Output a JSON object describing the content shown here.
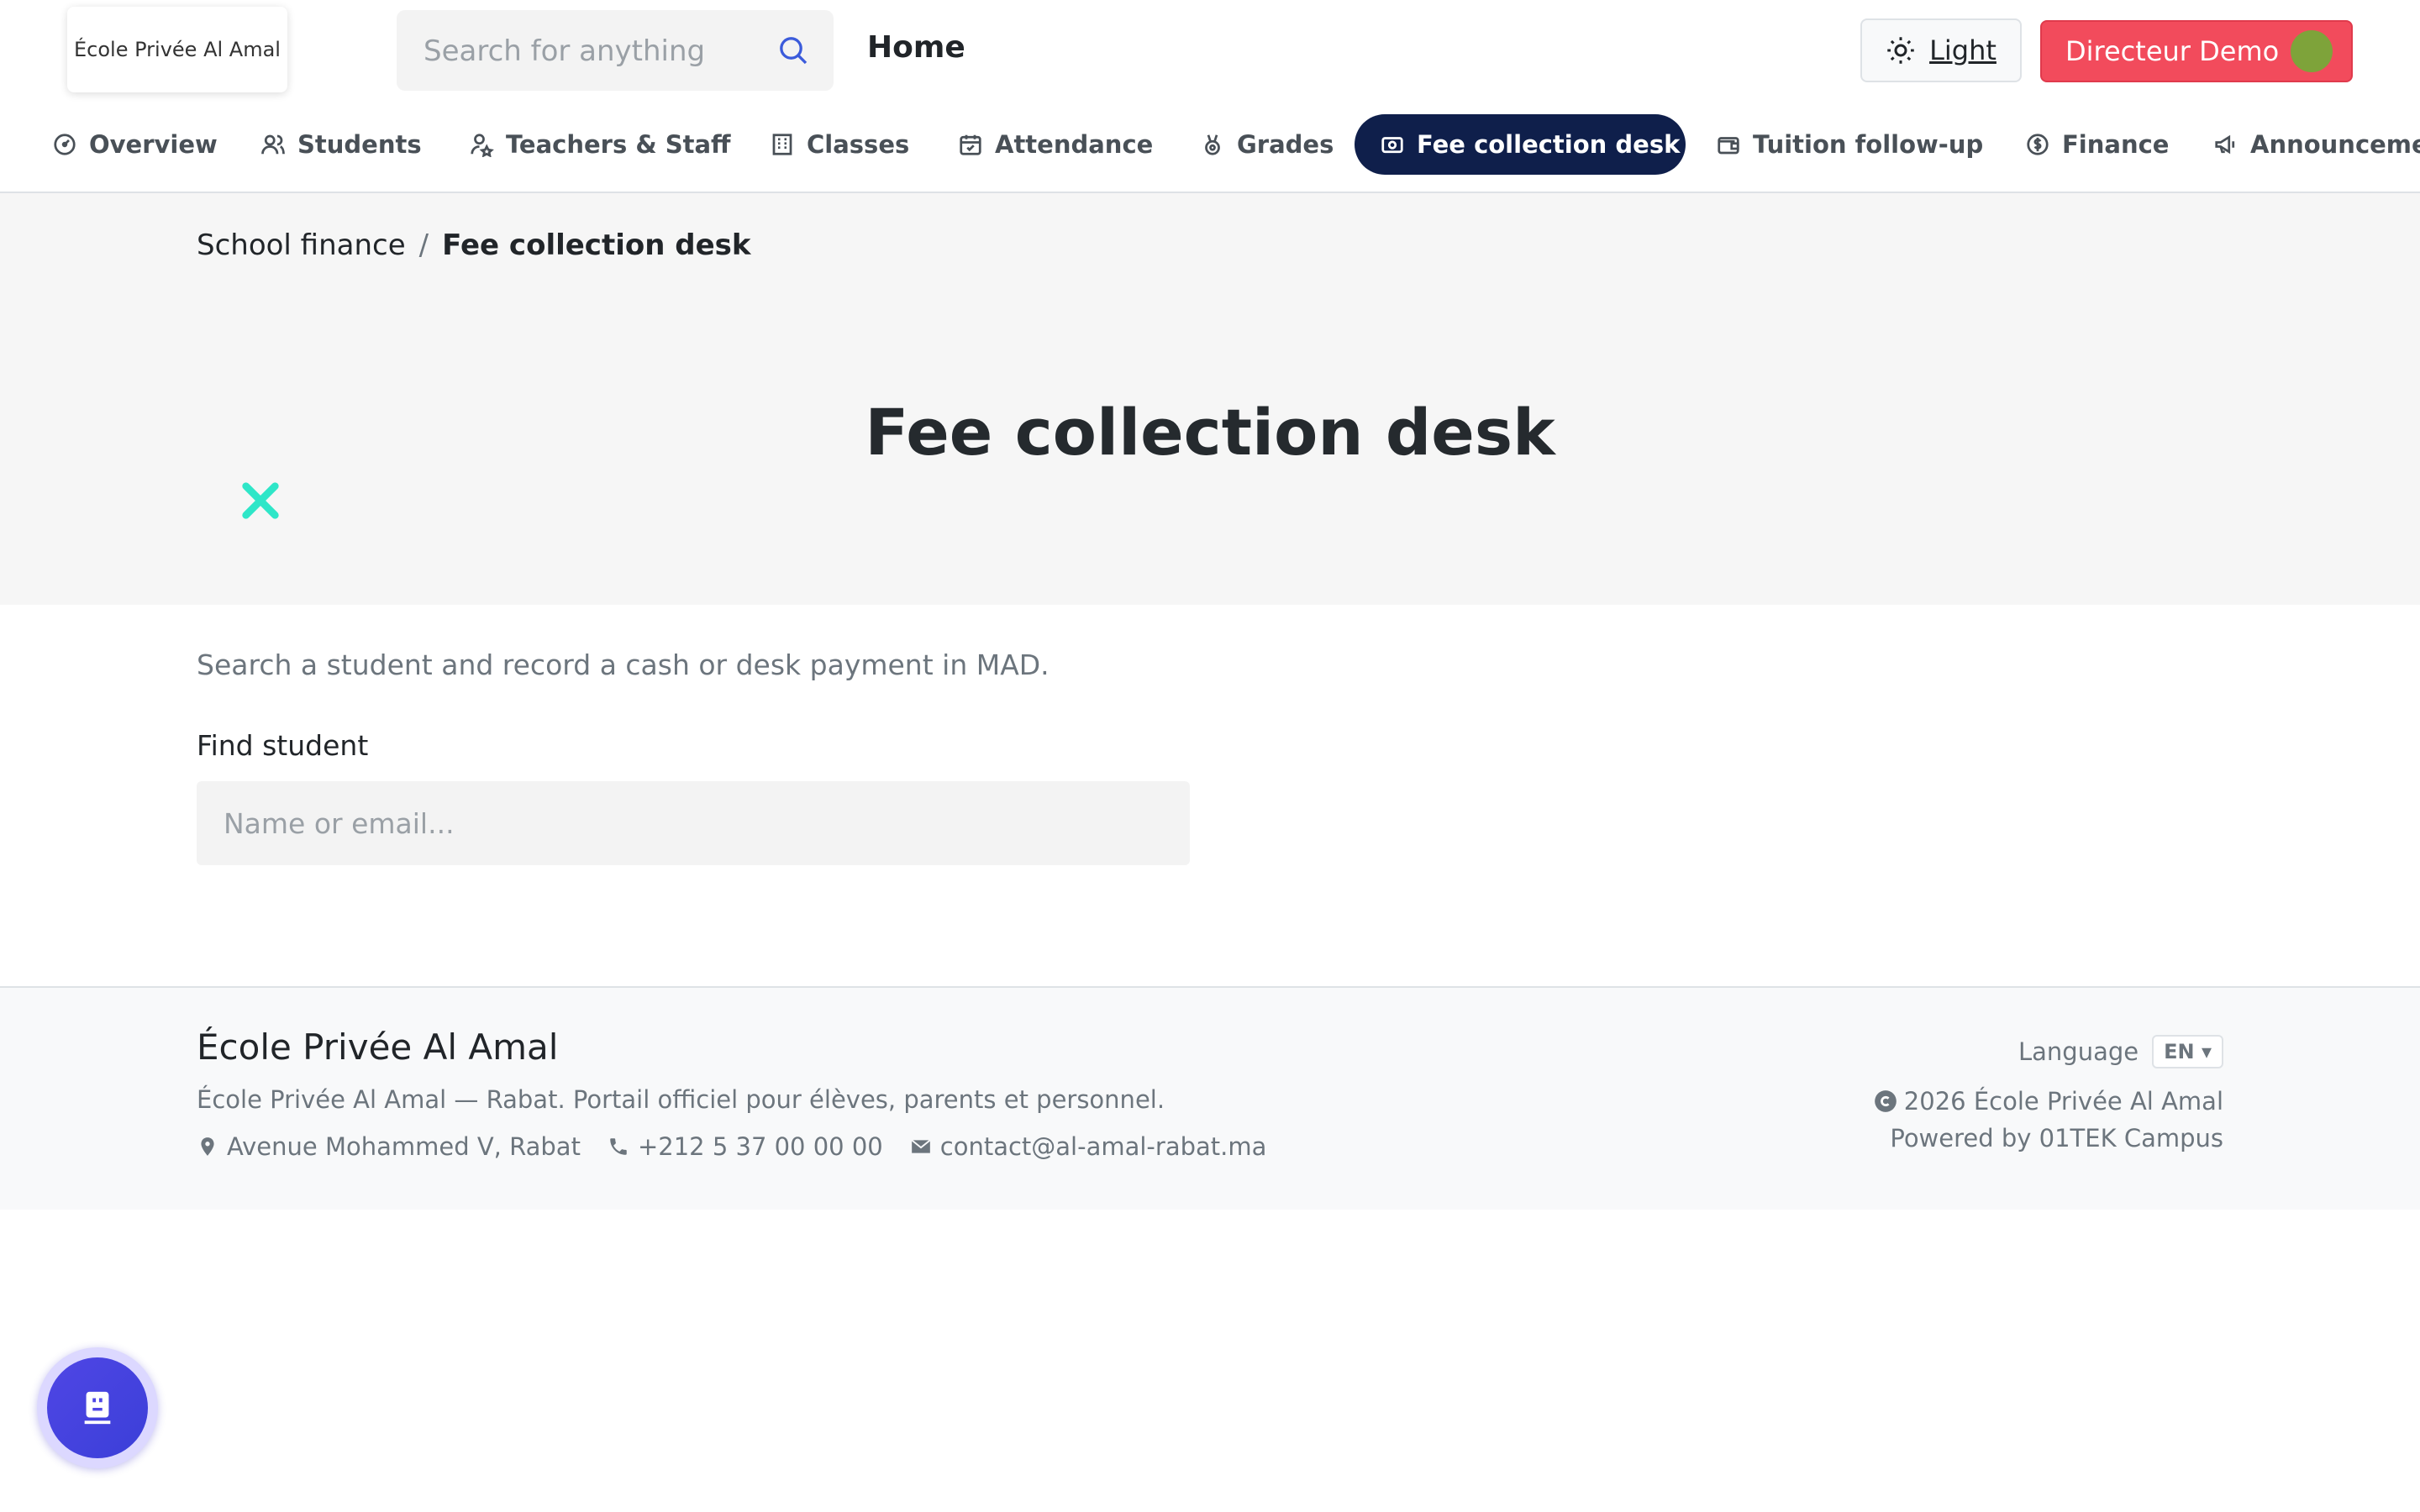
{
  "header": {
    "logo_text": "École Privée Al Amal",
    "search_placeholder": "Search for anything",
    "home_label": "Home",
    "theme_label": "Light",
    "user_name": "Directeur Demo"
  },
  "nav": {
    "items": [
      {
        "label": "Overview",
        "icon": "dashboard-icon"
      },
      {
        "label": "Students",
        "icon": "students-icon"
      },
      {
        "label": "Teachers & Staff",
        "icon": "teacher-icon"
      },
      {
        "label": "Classes",
        "icon": "building-icon"
      },
      {
        "label": "Attendance",
        "icon": "calendar-check-icon"
      },
      {
        "label": "Grades",
        "icon": "medal-icon"
      },
      {
        "label": "Fee collection desk",
        "icon": "cash-icon",
        "active": true
      },
      {
        "label": "Tuition follow-up",
        "icon": "wallet-icon"
      },
      {
        "label": "Finance",
        "icon": "coin-icon"
      },
      {
        "label": "Announcements",
        "icon": "megaphone-icon"
      }
    ]
  },
  "breadcrumb": {
    "parent": "School finance",
    "separator": "/",
    "current": "Fee collection desk"
  },
  "page": {
    "title": "Fee collection desk",
    "subtitle": "Search a student and record a cash or desk payment in MAD.",
    "find_label": "Find student",
    "find_placeholder": "Name or email..."
  },
  "footer": {
    "school_name": "École Privée Al Amal",
    "description": "École Privée Al Amal — Rabat. Portail officiel pour élèves, parents et personnel.",
    "address": "Avenue Mohammed V, Rabat",
    "phone": "+212 5 37 00 00 00",
    "email": "contact@al-amal-rabat.ma",
    "language_label": "Language",
    "language_value": "EN ▾",
    "copyright": "2026 École Privée Al Amal",
    "powered_by": "Powered by 01TEK Campus"
  },
  "colors": {
    "active_nav": "#0f1f4b",
    "user_button": "#f24b5c",
    "close_x": "#2ee6c8",
    "bot_button": "#4f46e5"
  }
}
